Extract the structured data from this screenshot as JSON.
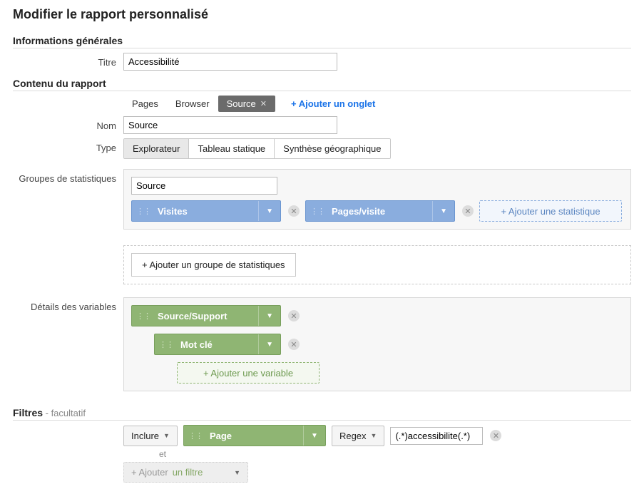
{
  "page_title": "Modifier le rapport personnalisé",
  "sections": {
    "general": "Informations générales",
    "content": "Contenu du rapport",
    "filters": "Filtres",
    "filters_optional": " - facultatif"
  },
  "labels": {
    "title": "Titre",
    "name": "Nom",
    "type": "Type",
    "stat_groups": "Groupes de statistiques",
    "var_details": "Détails des variables"
  },
  "values": {
    "title": "Accessibilité",
    "name": "Source",
    "group_name": "Source",
    "filter_value": "(.*)accessibilite(.*)"
  },
  "tabs": {
    "pages": "Pages",
    "browser": "Browser",
    "source": "Source",
    "add": "+ Ajouter un onglet"
  },
  "type_opts": {
    "explorer": "Explorateur",
    "static": "Tableau statique",
    "geo": "Synthèse géographique"
  },
  "metrics": {
    "visits": "Visites",
    "pages_visite": "Pages/visite"
  },
  "dimensions": {
    "source_support": "Source/Support",
    "keyword": "Mot clé",
    "page": "Page"
  },
  "buttons": {
    "add_stat": "+ Ajouter une statistique",
    "add_group": "+ Ajouter un groupe de statistiques",
    "add_var": "+ Ajouter une variable",
    "include": "Inclure",
    "regex": "Regex",
    "add_filter_prefix": "+ Ajouter ",
    "add_filter_hl": "un filtre",
    "and": "et"
  }
}
